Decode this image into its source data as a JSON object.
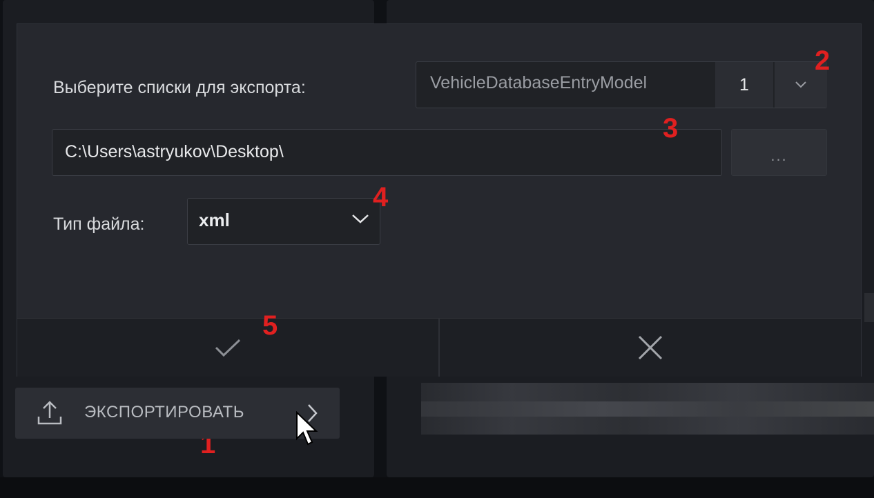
{
  "dialog": {
    "lists_label": "Выберите списки для экспорта:",
    "lists_value": "VehicleDatabaseEntryModel",
    "lists_count": "1",
    "path_value": "C:\\Users\\astryukov\\Desktop\\",
    "browse_label": "...",
    "file_type_label": "Тип файла:",
    "file_type_value": "xml"
  },
  "export_button": {
    "label": "ЭКСПОРТИРОВАТЬ"
  },
  "annotations": {
    "m1": "1",
    "m2": "2",
    "m3": "3",
    "m4": "4",
    "m5": "5"
  },
  "icons": {
    "ok": "check-icon",
    "cancel": "close-icon",
    "export": "upload-icon",
    "dropdown": "chevron-down-icon",
    "submenu": "chevron-right-icon",
    "pointer": "mouse-cursor-icon"
  },
  "colors": {
    "annotation": "#e02020",
    "dialog_bg": "#26282e",
    "page_bg": "#0f1115"
  }
}
